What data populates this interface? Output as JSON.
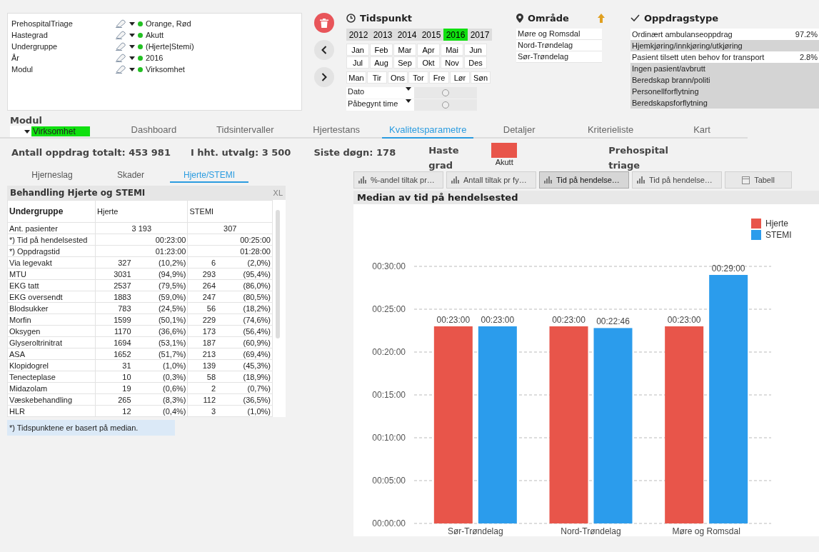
{
  "current_selections": [
    {
      "field": "PrehospitalTriage",
      "value": "Orange, Rød"
    },
    {
      "field": "Hastegrad",
      "value": "Akutt"
    },
    {
      "field": "Undergruppe",
      "value": "(Hjerte|Stemi)"
    },
    {
      "field": "År",
      "value": "2016"
    },
    {
      "field": "Modul",
      "value": "Virksomhet"
    }
  ],
  "tidspunkt": {
    "title": "Tidspunkt",
    "years": [
      {
        "label": "2012",
        "selected": false
      },
      {
        "label": "2013",
        "selected": false
      },
      {
        "label": "2014",
        "selected": false
      },
      {
        "label": "2015",
        "selected": false
      },
      {
        "label": "2016",
        "selected": true
      },
      {
        "label": "2017",
        "selected": false
      }
    ],
    "months": [
      "Jan",
      "Feb",
      "Mar",
      "Apr",
      "Mai",
      "Jun",
      "Jul",
      "Aug",
      "Sep",
      "Okt",
      "Nov",
      "Des"
    ],
    "weekdays": [
      "Man",
      "Tir",
      "Ons",
      "Tor",
      "Fre",
      "Lør",
      "Søn"
    ],
    "sliders": [
      {
        "label": "Dato",
        "level": 0.5
      },
      {
        "label": "Påbegynt time",
        "level": 0.5
      }
    ]
  },
  "omrade": {
    "title": "Område",
    "items": [
      "Møre og Romsdal",
      "Nord-Trøndelag",
      "Sør-Trøndelag"
    ]
  },
  "oppdragstype": {
    "title": "Oppdragstype",
    "items": [
      {
        "label": "Ordinært ambulanseoppdrag",
        "share": "97.2%",
        "excluded": false
      },
      {
        "label": "Hjemkjøring/innkjøring/utkjøring",
        "excluded": true
      },
      {
        "label": "Pasient tilsett uten behov for transport",
        "share": "2.8%",
        "excluded": false
      },
      {
        "label": "Ingen pasient/avbrutt",
        "excluded": true
      },
      {
        "label": "Beredskap brann/politi",
        "excluded": true
      },
      {
        "label": "Personellforflytning",
        "excluded": true
      },
      {
        "label": "Beredskapsforflytning",
        "excluded": true
      }
    ]
  },
  "modul": {
    "label": "Modul",
    "value": "Virksomhet"
  },
  "tabs": [
    {
      "label": "Dashboard",
      "selected": false
    },
    {
      "label": "Tidsintervaller",
      "selected": false
    },
    {
      "label": "Hjertestans",
      "selected": false
    },
    {
      "label": "Kvalitetsparametre",
      "selected": true
    },
    {
      "label": "Detaljer",
      "selected": false
    },
    {
      "label": "Kriterieliste",
      "selected": false
    },
    {
      "label": "Kart",
      "selected": false
    }
  ],
  "stats": {
    "total": "Antall oppdrag totalt: 453 981",
    "selection": "I hht. utvalg: 3 500",
    "last_day": "Siste døgn: 178",
    "hastegrad_label": "Haste grad",
    "hastegrad_legend": [
      {
        "label": "Akutt",
        "color": "#e8554a"
      }
    ],
    "triage_label": "Prehospital triage"
  },
  "subtabs": [
    {
      "label": "Hjerneslag",
      "selected": false
    },
    {
      "label": "Skader",
      "selected": false
    },
    {
      "label": "Hjerte/STEMI",
      "selected": true
    }
  ],
  "table": {
    "title": "Behandling Hjerte og STEMI",
    "export": "XL",
    "columns": [
      "Undergruppe",
      "Hjerte",
      "STEMI"
    ],
    "rows": [
      {
        "kind": "total",
        "label": "Ant. pasienter",
        "hjerte": "3 193",
        "stemi": "307"
      },
      {
        "kind": "time",
        "label": "*) Tid på hendelsested",
        "hjerte": "00:23:00",
        "stemi": "00:25:00"
      },
      {
        "kind": "time",
        "label": "*) Oppdragstid",
        "hjerte": "01:23:00",
        "stemi": "01:28:00"
      },
      {
        "kind": "count",
        "label": "Via legevakt",
        "hjerte": "327",
        "hjerte_pct": "(10,2%)",
        "stemi": "6",
        "stemi_pct": "(2,0%)"
      },
      {
        "kind": "count",
        "label": "MTU",
        "hjerte": "3031",
        "hjerte_pct": "(94,9%)",
        "stemi": "293",
        "stemi_pct": "(95,4%)"
      },
      {
        "kind": "count",
        "label": "EKG tatt",
        "hjerte": "2537",
        "hjerte_pct": "(79,5%)",
        "stemi": "264",
        "stemi_pct": "(86,0%)"
      },
      {
        "kind": "count",
        "label": "EKG oversendt",
        "hjerte": "1883",
        "hjerte_pct": "(59,0%)",
        "stemi": "247",
        "stemi_pct": "(80,5%)"
      },
      {
        "kind": "count",
        "label": "Blodsukker",
        "hjerte": "783",
        "hjerte_pct": "(24,5%)",
        "stemi": "56",
        "stemi_pct": "(18,2%)"
      },
      {
        "kind": "count",
        "label": "Morfin",
        "hjerte": "1599",
        "hjerte_pct": "(50,1%)",
        "stemi": "229",
        "stemi_pct": "(74,6%)"
      },
      {
        "kind": "count",
        "label": "Oksygen",
        "hjerte": "1170",
        "hjerte_pct": "(36,6%)",
        "stemi": "173",
        "stemi_pct": "(56,4%)"
      },
      {
        "kind": "count",
        "label": "Glyseroltrinitrat",
        "hjerte": "1694",
        "hjerte_pct": "(53,1%)",
        "stemi": "187",
        "stemi_pct": "(60,9%)"
      },
      {
        "kind": "count",
        "label": "ASA",
        "hjerte": "1652",
        "hjerte_pct": "(51,7%)",
        "stemi": "213",
        "stemi_pct": "(69,4%)"
      },
      {
        "kind": "count",
        "label": "Klopidogrel",
        "hjerte": "31",
        "hjerte_pct": "(1,0%)",
        "stemi": "139",
        "stemi_pct": "(45,3%)"
      },
      {
        "kind": "count",
        "label": "Tenecteplase",
        "hjerte": "10",
        "hjerte_pct": "(0,3%)",
        "stemi": "58",
        "stemi_pct": "(18,9%)"
      },
      {
        "kind": "count",
        "label": "Midazolam",
        "hjerte": "19",
        "hjerte_pct": "(0,6%)",
        "stemi": "2",
        "stemi_pct": "(0,7%)"
      },
      {
        "kind": "count",
        "label": "Væskebehandling",
        "hjerte": "265",
        "hjerte_pct": "(8,3%)",
        "stemi": "112",
        "stemi_pct": "(36,5%)"
      },
      {
        "kind": "count",
        "label": "HLR",
        "hjerte": "12",
        "hjerte_pct": "(0,4%)",
        "stemi": "3",
        "stemi_pct": "(1,0%)"
      }
    ],
    "note": "*) Tidspunktene er basert på median."
  },
  "chart_tabs": [
    {
      "label": "%-andel tiltak pr…",
      "selected": false,
      "kind": "chart"
    },
    {
      "label": "Antall tiltak pr fy…",
      "selected": false,
      "kind": "chart"
    },
    {
      "label": "Tid på hendelse…",
      "selected": true,
      "kind": "chart"
    },
    {
      "label": "Tid på hendelse…",
      "selected": false,
      "kind": "chart"
    },
    {
      "label": "Tabell",
      "selected": false,
      "kind": "table"
    }
  ],
  "chart": {
    "title": "Median av tid på hendelsested",
    "chart_data": {
      "type": "bar",
      "categories": [
        "Sør-Trøndelag",
        "Nord-Trøndelag",
        "Møre og Romsdal"
      ],
      "series": [
        {
          "name": "Hjerte",
          "color": "#e8554a",
          "values": [
            23,
            23,
            23
          ]
        },
        {
          "name": "STEMI",
          "color": "#2b9cec",
          "values": [
            23,
            22.8,
            29
          ]
        }
      ],
      "ylim": [
        0,
        30
      ],
      "grid": true,
      "legend": true,
      "yticks": [
        {
          "value": 0,
          "label": "00:00:00"
        },
        {
          "value": 5,
          "label": "00:05:00"
        },
        {
          "value": 10,
          "label": "00:10:00"
        },
        {
          "value": 15,
          "label": "00:15:00"
        },
        {
          "value": 20,
          "label": "00:20:00"
        },
        {
          "value": 25,
          "label": "00:25:00"
        },
        {
          "value": 30,
          "label": "00:30:00"
        }
      ],
      "value_labels": [
        [
          "00:23:00",
          "00:23:00",
          "00:23:00"
        ],
        [
          "00:23:00",
          "00:22:46",
          "00:29:00"
        ]
      ]
    }
  }
}
